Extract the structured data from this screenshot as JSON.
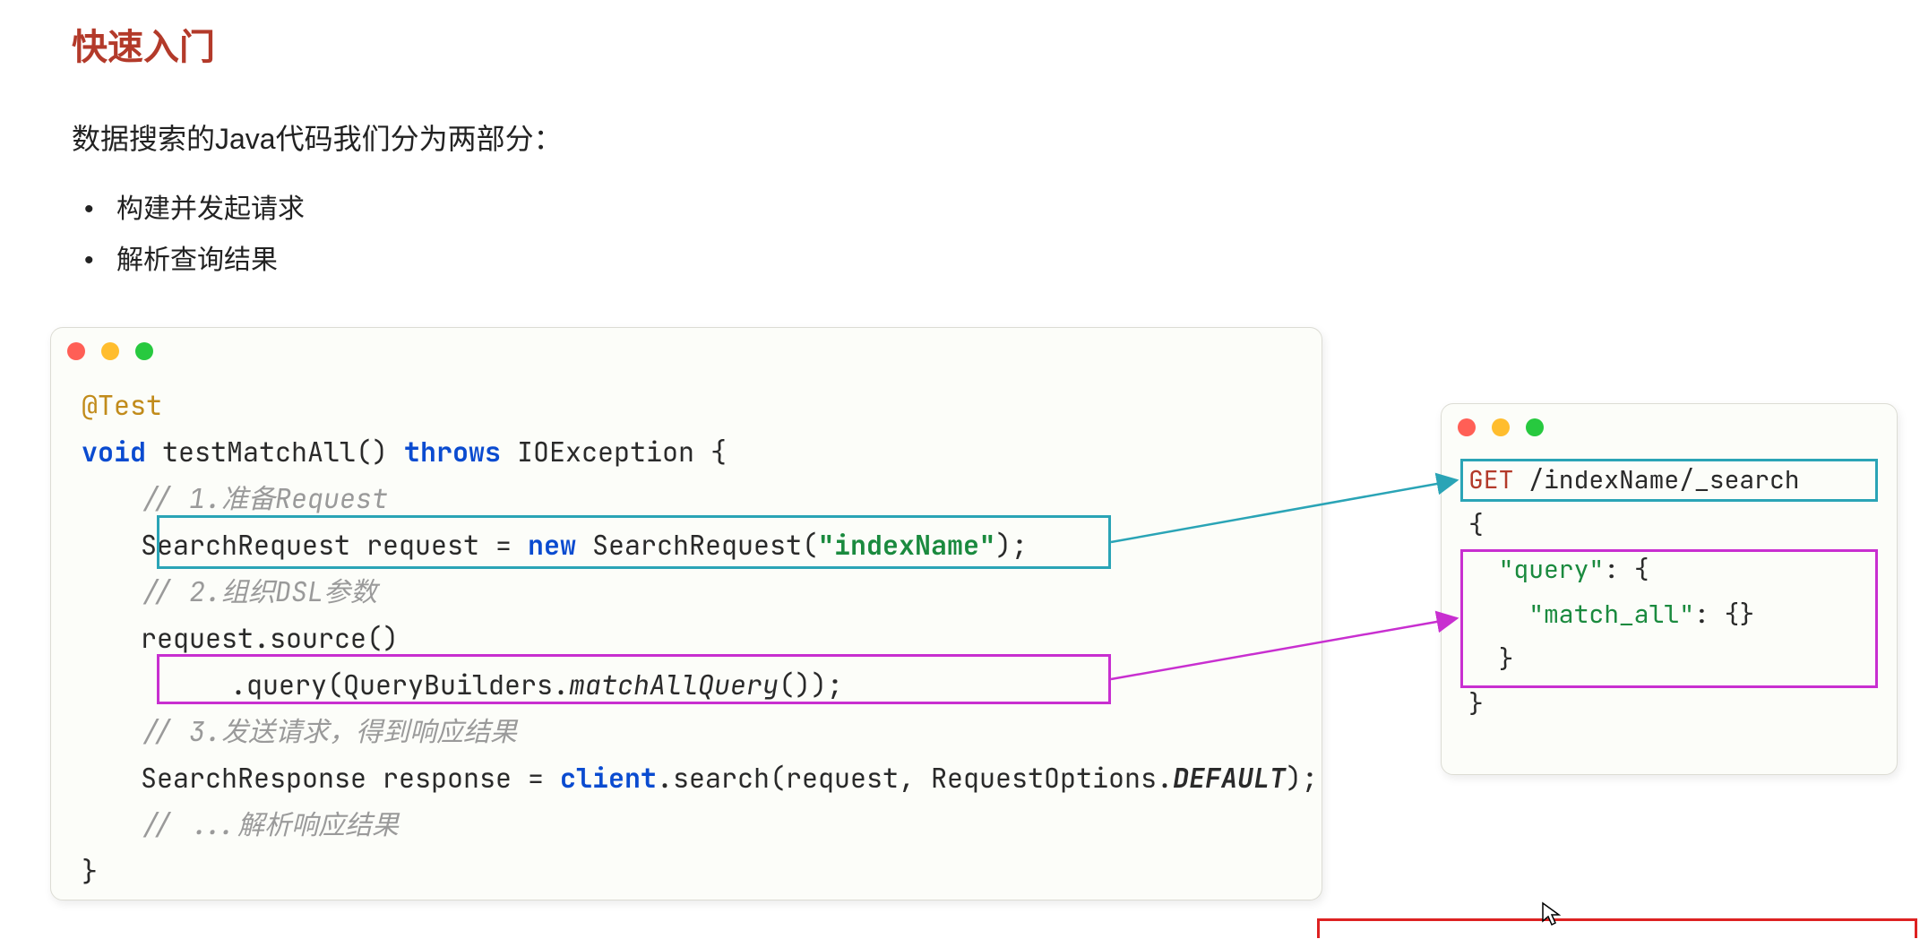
{
  "heading": "快速入门",
  "intro": "数据搜索的Java代码我们分为两部分：",
  "bullets": [
    "构建并发起请求",
    "解析查询结果"
  ],
  "colors": {
    "heading": "#b33a2a",
    "teal": "#2aa4b6",
    "magenta": "#c82fd0"
  },
  "code_left": {
    "annotation": "@Test",
    "kw_void": "void",
    "fn_sig_open": " testMatchAll() ",
    "kw_throws": "throws",
    "sig_rest": " IOException {",
    "c1": "// 1.准备Request",
    "l2_pre": "SearchRequest request = ",
    "kw_new": "new",
    "l2_mid": " SearchRequest(",
    "l2_str": "\"indexName\"",
    "l2_post": ");",
    "c2": "// 2.组织DSL参数",
    "l3": "request.source()",
    "l4_pre": ".query(QueryBuilders.",
    "l4_mid": "matchAllQuery",
    "l4_post": "());",
    "c3": "// 3.发送请求，得到响应结果",
    "l5_pre": "SearchResponse response = ",
    "l5_client": "client",
    "l5_mid": ".search(request, RequestOptions.",
    "l5_def": "DEFAULT",
    "l5_post": ");",
    "c4": "// ...解析响应结果",
    "close": "}"
  },
  "code_right": {
    "r1_get": "GET",
    "r1_path": " /indexName/_search",
    "r2": "{",
    "r3_pre": "  ",
    "r3_key": "\"query\"",
    "r3_post": ": {",
    "r4_pre": "    ",
    "r4_key": "\"match_all\"",
    "r4_post": ": {}",
    "r5": "  }",
    "r6": "}"
  }
}
